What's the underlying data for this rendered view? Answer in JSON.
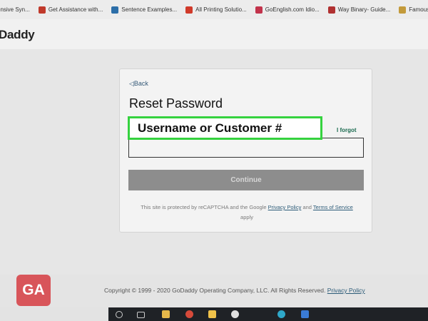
{
  "bookmarks": [
    {
      "label": "ensive Syn...",
      "color": "#c4c4c4"
    },
    {
      "label": "Get Assistance with...",
      "color": "#c0392b"
    },
    {
      "label": "Sentence Examples...",
      "color": "#2c6ea8"
    },
    {
      "label": "All Printing Solutio...",
      "color": "#d03a2a"
    },
    {
      "label": "GoEnglish.com Idio...",
      "color": "#c2334b"
    },
    {
      "label": "Way Binary- Guide...",
      "color": "#b03030"
    },
    {
      "label": "Famous",
      "color": "#c39a3a"
    }
  ],
  "header": {
    "logo": "Daddy"
  },
  "card": {
    "back_label": "Back",
    "title": "Reset Password",
    "field_label": "Username or Customer #",
    "forgot_label": "I forgot",
    "input_value": "",
    "continue_label": "Continue",
    "legal": {
      "prefix": "This site is protected by reCAPTCHA and the Google",
      "privacy": "Privacy Policy",
      "and": "and",
      "terms": "Terms of Service",
      "suffix": "apply"
    }
  },
  "footer": {
    "copyright": "Copyright © 1999 - 2020 GoDaddy Operating Company, LLC. All Rights Reserved.",
    "privacy": "Privacy Policy"
  },
  "badge": {
    "text": "GA",
    "color": "#d8555a"
  },
  "colors": {
    "highlight": "#35d23f",
    "link": "#2c5b78",
    "continue_bg": "#8d8d8d"
  }
}
